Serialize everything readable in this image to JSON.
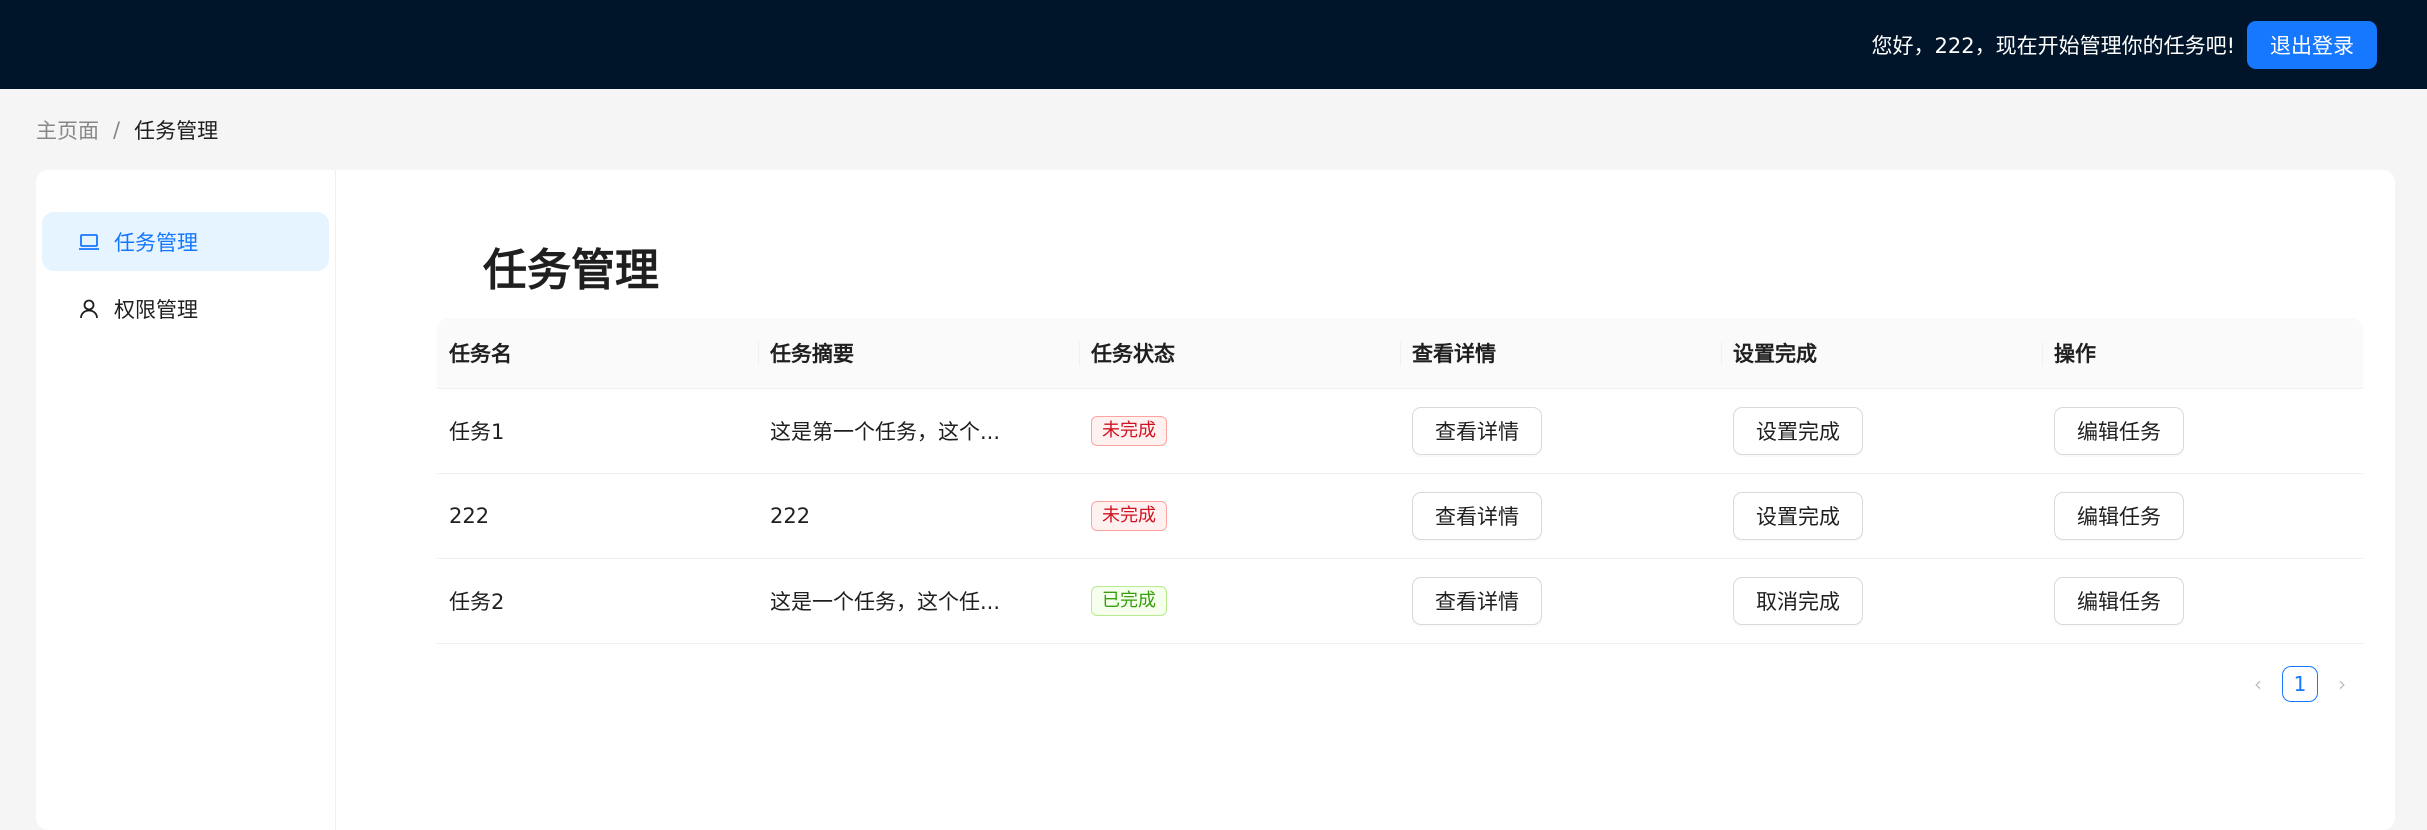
{
  "header": {
    "greeting": "您好，222，现在开始管理你的任务吧!",
    "logout_label": "退出登录"
  },
  "breadcrumb": {
    "home": "主页面",
    "separator": "/",
    "current": "任务管理"
  },
  "sidebar": {
    "items": [
      {
        "label": "任务管理",
        "icon": "laptop-icon",
        "active": true
      },
      {
        "label": "权限管理",
        "icon": "user-icon",
        "active": false
      }
    ]
  },
  "main": {
    "title": "任务管理",
    "columns": [
      "任务名",
      "任务摘要",
      "任务状态",
      "查看详情",
      "设置完成",
      "操作"
    ],
    "rows": [
      {
        "name": "任务1",
        "summary": "这是第一个任务，这个...",
        "status": "未完成",
        "detail_label": "查看详情",
        "toggle_label": "设置完成",
        "edit_label": "编辑任务"
      },
      {
        "name": "222",
        "summary": "222",
        "status": "未完成",
        "detail_label": "查看详情",
        "toggle_label": "设置完成",
        "edit_label": "编辑任务"
      },
      {
        "name": "任务2",
        "summary": "这是一个任务，这个任...",
        "status": "已完成",
        "detail_label": "查看详情",
        "toggle_label": "取消完成",
        "edit_label": "编辑任务"
      }
    ],
    "pagination": {
      "current_page": "1"
    }
  },
  "colors": {
    "header_bg": "#001529",
    "primary": "#1677ff",
    "status_incomplete": "#cf1322",
    "status_complete": "#389e0d"
  }
}
